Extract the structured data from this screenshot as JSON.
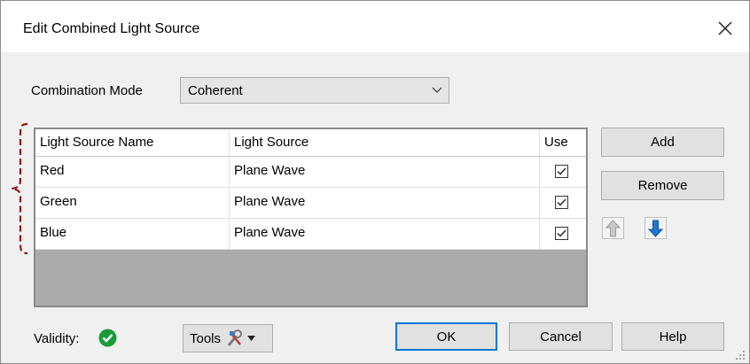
{
  "dialog": {
    "title": "Edit Combined Light Source",
    "close_icon": "close-icon"
  },
  "combination_mode": {
    "label": "Combination Mode",
    "value": "Coherent",
    "icon": "chevron-down-icon"
  },
  "table": {
    "columns": [
      "Light Source Name",
      "Light Source",
      "Use"
    ],
    "rows": [
      {
        "name": "Red",
        "source": "Plane Wave",
        "use": true
      },
      {
        "name": "Green",
        "source": "Plane Wave",
        "use": true
      },
      {
        "name": "Blue",
        "source": "Plane Wave",
        "use": true
      }
    ]
  },
  "side_buttons": {
    "add": "Add",
    "remove": "Remove",
    "move_up_icon": "arrow-up-icon",
    "move_down_icon": "arrow-down-icon"
  },
  "footer": {
    "validity_label": "Validity:",
    "validity_icon": "check-circle-icon",
    "tools_label": "Tools",
    "tools_icon": "tools-icon",
    "ok": "OK",
    "cancel": "Cancel",
    "help": "Help"
  },
  "colors": {
    "dialog_bg": "#f0f0f0",
    "grid_bg": "#ababab",
    "default_button_border": "#0078d7",
    "validity_green": "#1a9c3a",
    "down_arrow_blue": "#1e78d2",
    "annotation_bracket": "#8b1a1a"
  }
}
